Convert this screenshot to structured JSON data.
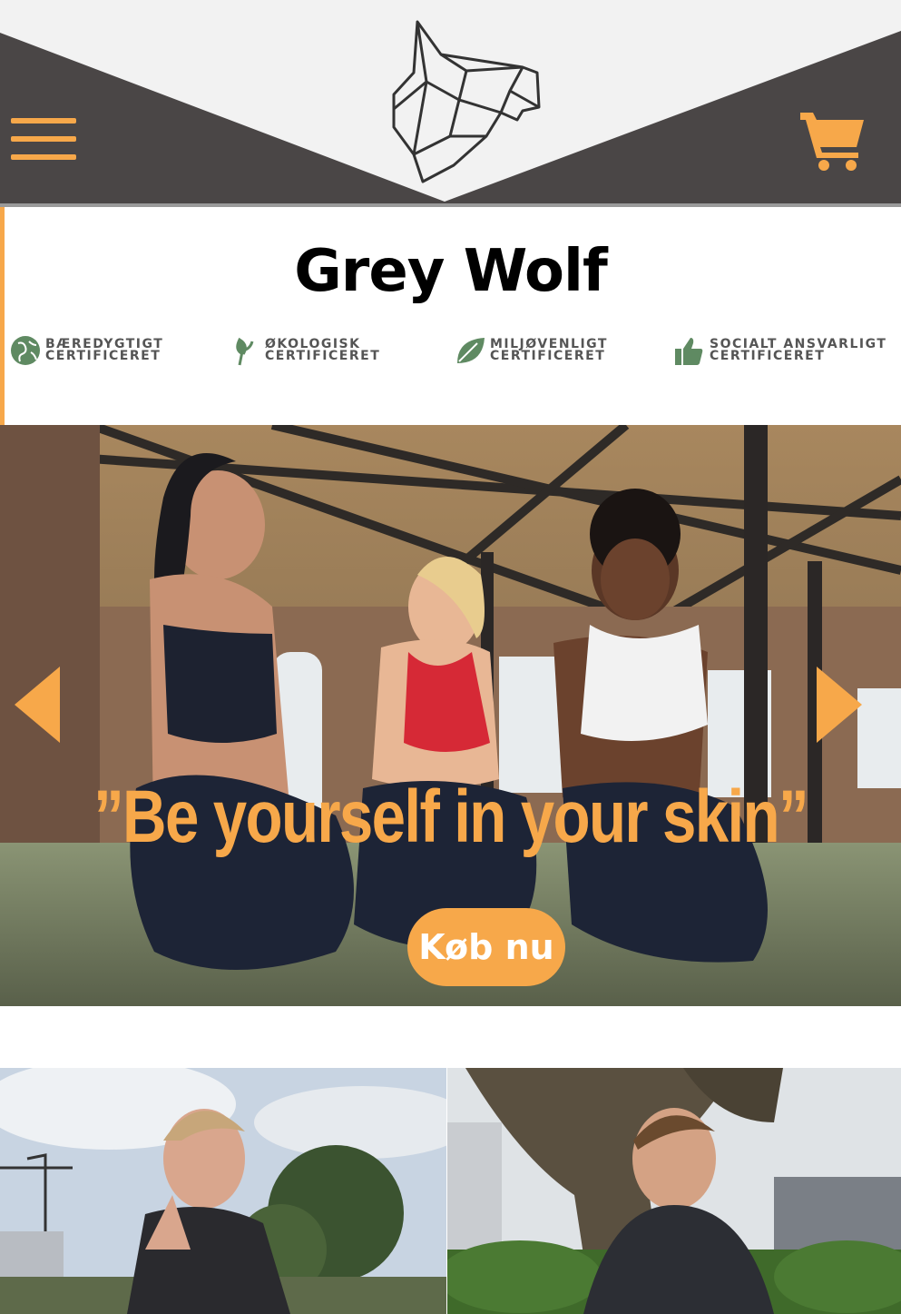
{
  "header": {
    "menu_icon": "hamburger-menu-icon",
    "logo_icon": "wolf-head-logo-icon",
    "cart_icon": "shopping-cart-icon"
  },
  "brand": {
    "title": "Grey Wolf"
  },
  "certifications": [
    {
      "icon": "globe-icon",
      "line1": "BÆREDYGTIGT",
      "line2": "CERTIFICERET"
    },
    {
      "icon": "leaf-sprout-icon",
      "line1": "ØKOLOGISK",
      "line2": "CERTIFICERET"
    },
    {
      "icon": "leaf-icon",
      "line1": "MILJØVENLIGT",
      "line2": "CERTIFICERET"
    },
    {
      "icon": "thumbs-up-icon",
      "line1": "SOCIALT ANSVARLIGT",
      "line2": "CERTIFICERET"
    }
  ],
  "hero": {
    "slogan": "”Be yourself in your skin”",
    "cta_label": "Køb nu",
    "prev_icon": "arrow-left-icon",
    "next_icon": "arrow-right-icon"
  },
  "colors": {
    "accent": "#f7a84a",
    "header_dark": "#4a4646",
    "header_light": "#f2f2f2"
  }
}
